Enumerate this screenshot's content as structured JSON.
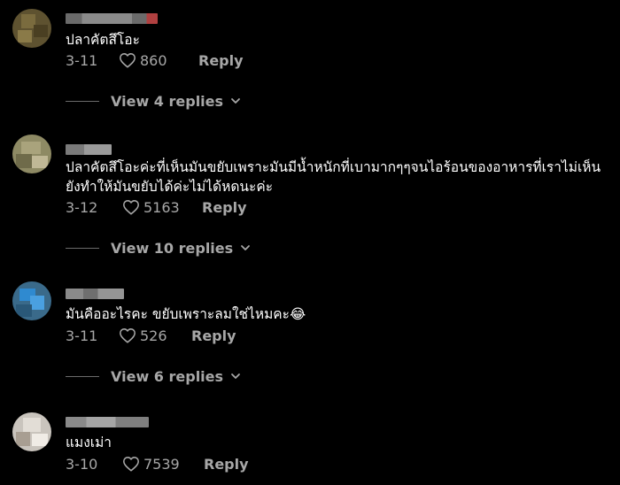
{
  "comments": [
    {
      "text": "ปลาคัตสึโอะ",
      "date": "3-11",
      "likes": "860",
      "reply_label": "Reply",
      "view_replies": "View 4 replies"
    },
    {
      "text": "ปลาคัตสึโอะค่ะที่เห็นมันขยับเพราะมันมีน้ำหนักที่เบามากๆๆจนไอร้อนของอาหารที่เราไม่เห็นยังทำให้มันขยับได้ค่ะไม่ได้หดนะค่ะ",
      "date": "3-12",
      "likes": "5163",
      "reply_label": "Reply",
      "view_replies": "View 10 replies"
    },
    {
      "text": "มันคืออะไรคะ ขยับเพราะลมใช่ไหมคะ😂",
      "date": "3-11",
      "likes": "526",
      "reply_label": "Reply",
      "view_replies": "View 6 replies"
    },
    {
      "text": "แมงเม่า",
      "date": "3-10",
      "likes": "7539",
      "reply_label": "Reply"
    }
  ],
  "colors": {
    "background": "#000000",
    "text": "#ffffff",
    "muted": "#a7a7a7"
  },
  "icons": {
    "like": "heart-outline-icon",
    "expand": "chevron-down-icon"
  }
}
